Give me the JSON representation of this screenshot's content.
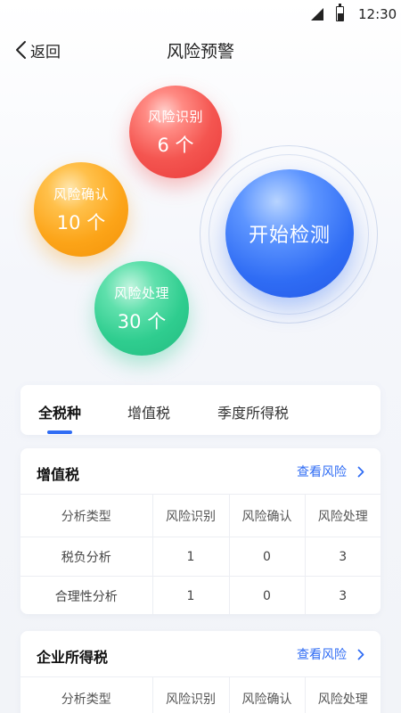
{
  "status_bar": {
    "time": "12:30",
    "icons": [
      "signal-icon",
      "battery-icon"
    ]
  },
  "nav": {
    "back_label": "返回",
    "title": "风险预警"
  },
  "bubbles": {
    "identify": {
      "title": "风险识别",
      "count": "6 个",
      "color": "#f45550"
    },
    "confirm": {
      "title": "风险确认",
      "count": "10 个",
      "color": "#fca418"
    },
    "handle": {
      "title": "风险处理",
      "count": "30 个",
      "color": "#2fcd8f"
    },
    "start": {
      "title": "开始检测",
      "color": "#2f6cf4"
    }
  },
  "tabs": [
    {
      "label": "全税种",
      "active": true
    },
    {
      "label": "增值税",
      "active": false
    },
    {
      "label": "季度所得税",
      "active": false
    }
  ],
  "accent_color": "#2f6cf4",
  "cards": [
    {
      "title": "增值税",
      "link_label": "查看风险",
      "columns": [
        "分析类型",
        "风险识别",
        "风险确认",
        "风险处理"
      ],
      "rows": [
        [
          "税负分析",
          "1",
          "0",
          "3"
        ],
        [
          "合理性分析",
          "1",
          "0",
          "3"
        ]
      ]
    },
    {
      "title": "企业所得税",
      "link_label": "查看风险",
      "columns": [
        "分析类型",
        "风险识别",
        "风险确认",
        "风险处理"
      ],
      "rows": []
    }
  ]
}
